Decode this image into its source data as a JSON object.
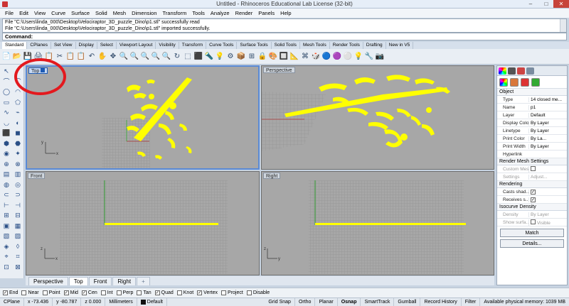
{
  "window": {
    "title": "Untitled - Rhinoceros Educational Lab License (32-bit)",
    "min": "–",
    "max": "□",
    "close": "✕"
  },
  "menu": [
    "File",
    "Edit",
    "View",
    "Curve",
    "Surface",
    "Solid",
    "Mesh",
    "Dimension",
    "Transform",
    "Tools",
    "Analyze",
    "Render",
    "Panels",
    "Help"
  ],
  "command": {
    "history": [
      "File \"C:\\Users\\linda_000\\Desktop\\Velociraptor_3D_puzzle_Dino\\p1.stl\" successfully read",
      "File \"C:\\Users\\linda_000\\Desktop\\Velociraptor_3D_puzzle_Dino\\p1.stl\" imported successfully."
    ],
    "prompt_label": "Command:",
    "value": ""
  },
  "toolbar_tabs": [
    "Standard",
    "CPlanes",
    "Set View",
    "Display",
    "Select",
    "Viewport Layout",
    "Visibility",
    "Transform",
    "Curve Tools",
    "Surface Tools",
    "Solid Tools",
    "Mesh Tools",
    "Render Tools",
    "Drafting",
    "New in V5"
  ],
  "toolbar_icons": [
    "📄",
    "📂",
    "💾",
    "🖨",
    "📋",
    "✂",
    "📋",
    "📋",
    "↶",
    "✋",
    "✥",
    "🔍",
    "🔍",
    "🔍",
    "🔍",
    "🔍",
    "↻",
    "⬚",
    "⬛",
    "🔦",
    "💡",
    "⚙",
    "📦",
    "⊞",
    "🔒",
    "🎨",
    "🔲",
    "📐",
    "⌘",
    "🎲",
    "🔵",
    "🟣",
    "⚪",
    "💡",
    "🔧",
    "📷"
  ],
  "sidebar_icons": [
    "↖",
    "·",
    "⌒",
    "⌒",
    "◯",
    "◠",
    "▭",
    "⬠",
    "∿",
    "⌁",
    "◡",
    "◐",
    "⬛",
    "◼",
    "⬢",
    "⬣",
    "◉",
    "✦",
    "⊕",
    "⊗",
    "▤",
    "▥",
    "◍",
    "◎",
    "⊂",
    "⊃",
    "⊢",
    "⊣",
    "⊞",
    "⊟",
    "▣",
    "▦",
    "▧",
    "▨",
    "◈",
    "◊",
    "⌖",
    "⌗",
    "⊡",
    "⊠"
  ],
  "viewports": {
    "top": {
      "label": "Top"
    },
    "perspective": {
      "label": "Perspective"
    },
    "front": {
      "label": "Front"
    },
    "right": {
      "label": "Right"
    }
  },
  "viewport_tabs": [
    "Perspective",
    "Top",
    "Front",
    "Right",
    "+"
  ],
  "osnaps": [
    {
      "label": "End",
      "checked": true
    },
    {
      "label": "Near",
      "checked": false
    },
    {
      "label": "Point",
      "checked": false
    },
    {
      "label": "Mid",
      "checked": true
    },
    {
      "label": "Cen",
      "checked": true
    },
    {
      "label": "Int",
      "checked": false
    },
    {
      "label": "Perp",
      "checked": false
    },
    {
      "label": "Tan",
      "checked": false
    },
    {
      "label": "Quad",
      "checked": true
    },
    {
      "label": "Knot",
      "checked": false
    },
    {
      "label": "Vertex",
      "checked": true
    },
    {
      "label": "Project",
      "checked": false
    },
    {
      "label": "Disable",
      "checked": false
    }
  ],
  "status": {
    "cplane": "CPlane",
    "x": "x -73.436",
    "y": "y -80.787",
    "z": "z 0.000",
    "units": "Millimeters",
    "layer": "Default",
    "grid_snap": "Grid Snap",
    "ortho": "Ortho",
    "planar": "Planar",
    "osnap": "Osnap",
    "smarttrack": "SmartTrack",
    "gumball": "Gumball",
    "record_history": "Record History",
    "filter": "Filter",
    "memory": "Available physical memory: 1039 MB"
  },
  "properties": {
    "section_object": "Object",
    "rows": [
      {
        "k": "Type",
        "v": "14 closed me..."
      },
      {
        "k": "Name",
        "v": "p1"
      },
      {
        "k": "Layer",
        "v": "Default"
      },
      {
        "k": "Display Color",
        "v": "By Layer"
      },
      {
        "k": "Linetype",
        "v": "By Layer"
      },
      {
        "k": "Print Color",
        "v": "By La..."
      },
      {
        "k": "Print Width",
        "v": "By Layer"
      },
      {
        "k": "Hyperlink",
        "v": ""
      }
    ],
    "section_render_mesh": "Render Mesh Settings",
    "custom_mesh": "Custom Mesh",
    "settings": "Settings",
    "adjust": "Adjust...",
    "section_rendering": "Rendering",
    "casts_shadows": "Casts shad...",
    "receives_shadows": "Receives s...",
    "section_isocurve": "Isocurve Density",
    "density": "Density",
    "density_value": "By Layer",
    "show_surface": "Show surfa...",
    "visible": "Visible",
    "match_button": "Match",
    "details_button": "Details...",
    "accent": "#1d5ab4"
  },
  "colors": {
    "object_yellow": "#ffff00",
    "grid": "#9a9a9a",
    "viewport_bg": "#a7a7a7",
    "annotation_red": "#e3191e"
  }
}
